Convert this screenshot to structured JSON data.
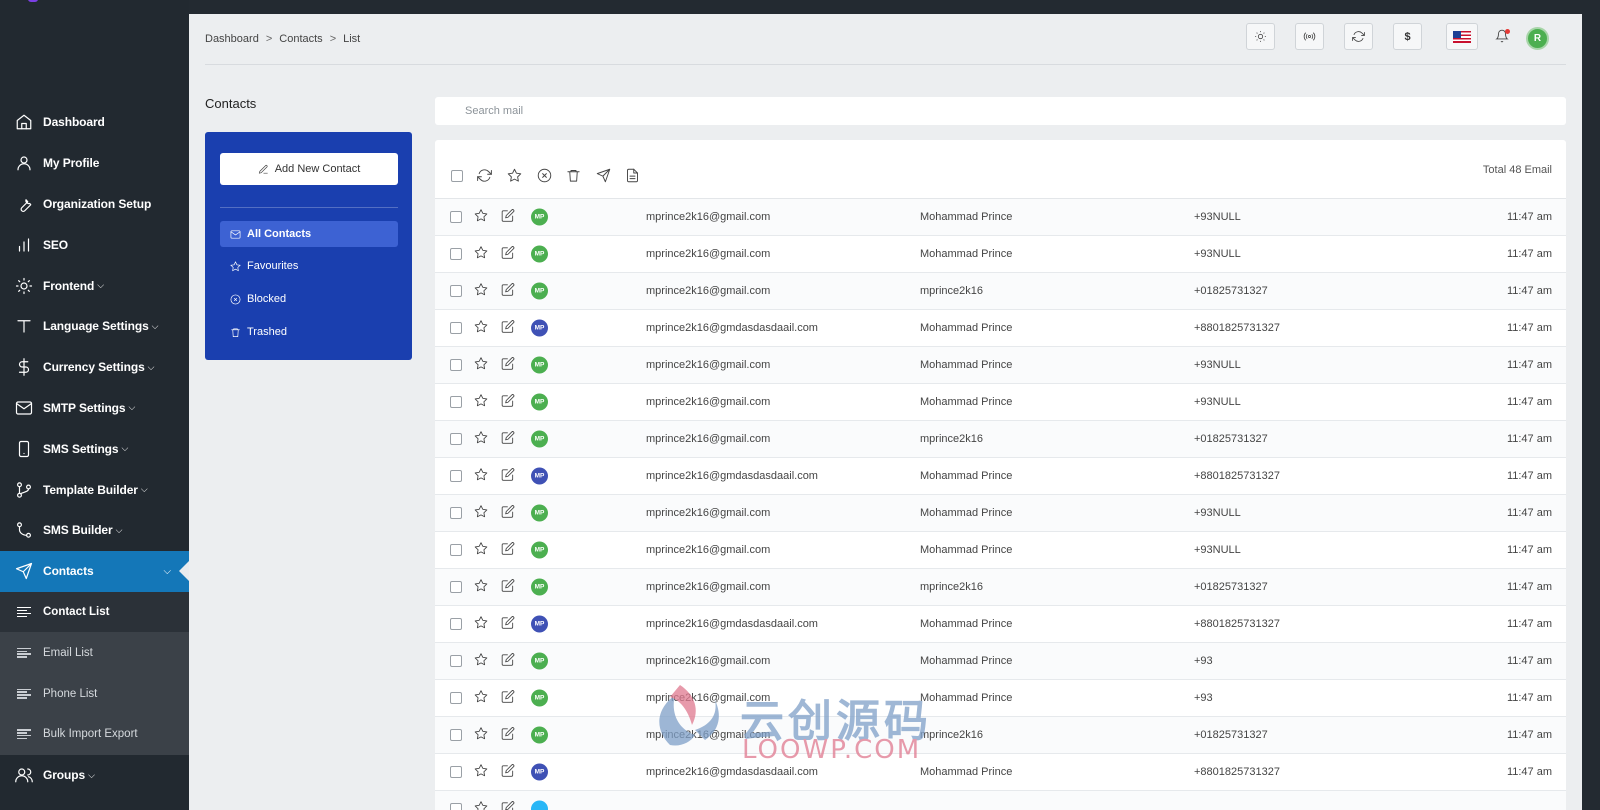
{
  "sidebar": {
    "items": [
      {
        "label": "Dashboard",
        "icon": "home-icon",
        "chevron": false
      },
      {
        "label": "My Profile",
        "icon": "user-icon",
        "chevron": false
      },
      {
        "label": "Organization Setup",
        "icon": "wrench-icon",
        "chevron": false
      },
      {
        "label": "SEO",
        "icon": "bar-chart-icon",
        "chevron": false
      },
      {
        "label": "Frontend",
        "icon": "sun-icon",
        "chevron": true
      },
      {
        "label": "Language Settings",
        "icon": "text-icon",
        "chevron": true
      },
      {
        "label": "Currency Settings",
        "icon": "dollar-icon",
        "chevron": true
      },
      {
        "label": "SMTP Settings",
        "icon": "mail-icon",
        "chevron": true
      },
      {
        "label": "SMS Settings",
        "icon": "phone-icon",
        "chevron": true
      },
      {
        "label": "Template Builder",
        "icon": "git-branch-icon",
        "chevron": true
      },
      {
        "label": "SMS Builder",
        "icon": "git-merge-icon",
        "chevron": true
      },
      {
        "label": "Contacts",
        "icon": "send-icon",
        "chevron": true,
        "active": true
      }
    ],
    "sub_items": [
      "Contact List",
      "Email List",
      "Phone List",
      "Bulk Import Export"
    ],
    "after_items": [
      {
        "label": "Groups",
        "icon": "users-icon",
        "chevron": true
      }
    ],
    "active_color": "#1477b8"
  },
  "header": {
    "breadcrumb": [
      "Dashboard",
      "Contacts",
      "List"
    ],
    "breadcrumb_sep": ">",
    "avatar_initial": "R",
    "currency_symbol": "$"
  },
  "contacts_panel": {
    "title": "Contacts",
    "add_button": "Add New Contact",
    "filters": [
      "All Contacts",
      "Favourites",
      "Blocked",
      "Trashed"
    ],
    "selected_filter": "All Contacts",
    "panel_color": "#1a3faf"
  },
  "search": {
    "placeholder": "Search mail"
  },
  "list": {
    "total_label": "Total 48 Email",
    "rows": [
      {
        "initials": "MP",
        "color": "#4caf50",
        "email": "mprince2k16@gmail.com",
        "name": "Mohammad Prince",
        "phone": "+93NULL",
        "time": "11:47 am"
      },
      {
        "initials": "MP",
        "color": "#4caf50",
        "email": "mprince2k16@gmail.com",
        "name": "Mohammad Prince",
        "phone": "+93NULL",
        "time": "11:47 am"
      },
      {
        "initials": "MP",
        "color": "#4caf50",
        "email": "mprince2k16@gmail.com",
        "name": "mprince2k16",
        "phone": "+01825731327",
        "time": "11:47 am"
      },
      {
        "initials": "MP",
        "color": "#3f51b5",
        "email": "mprince2k16@gmdasdasdaail.com",
        "name": "Mohammad Prince",
        "phone": "+8801825731327",
        "time": "11:47 am"
      },
      {
        "initials": "MP",
        "color": "#4caf50",
        "email": "mprince2k16@gmail.com",
        "name": "Mohammad Prince",
        "phone": "+93NULL",
        "time": "11:47 am"
      },
      {
        "initials": "MP",
        "color": "#4caf50",
        "email": "mprince2k16@gmail.com",
        "name": "Mohammad Prince",
        "phone": "+93NULL",
        "time": "11:47 am"
      },
      {
        "initials": "MP",
        "color": "#4caf50",
        "email": "mprince2k16@gmail.com",
        "name": "mprince2k16",
        "phone": "+01825731327",
        "time": "11:47 am"
      },
      {
        "initials": "MP",
        "color": "#3f51b5",
        "email": "mprince2k16@gmdasdasdaail.com",
        "name": "Mohammad Prince",
        "phone": "+8801825731327",
        "time": "11:47 am"
      },
      {
        "initials": "MP",
        "color": "#4caf50",
        "email": "mprince2k16@gmail.com",
        "name": "Mohammad Prince",
        "phone": "+93NULL",
        "time": "11:47 am"
      },
      {
        "initials": "MP",
        "color": "#4caf50",
        "email": "mprince2k16@gmail.com",
        "name": "Mohammad Prince",
        "phone": "+93NULL",
        "time": "11:47 am"
      },
      {
        "initials": "MP",
        "color": "#4caf50",
        "email": "mprince2k16@gmail.com",
        "name": "mprince2k16",
        "phone": "+01825731327",
        "time": "11:47 am"
      },
      {
        "initials": "MP",
        "color": "#3f51b5",
        "email": "mprince2k16@gmdasdasdaail.com",
        "name": "Mohammad Prince",
        "phone": "+8801825731327",
        "time": "11:47 am"
      },
      {
        "initials": "MP",
        "color": "#4caf50",
        "email": "mprince2k16@gmail.com",
        "name": "Mohammad Prince",
        "phone": "+93",
        "time": "11:47 am"
      },
      {
        "initials": "MP",
        "color": "#4caf50",
        "email": "mprince2k16@gmail.com",
        "name": "Mohammad Prince",
        "phone": "+93",
        "time": "11:47 am"
      },
      {
        "initials": "MP",
        "color": "#4caf50",
        "email": "mprince2k16@gmail.com",
        "name": "mprince2k16",
        "phone": "+01825731327",
        "time": "11:47 am"
      },
      {
        "initials": "MP",
        "color": "#3f51b5",
        "email": "mprince2k16@gmdasdasdaail.com",
        "name": "Mohammad Prince",
        "phone": "+8801825731327",
        "time": "11:47 am"
      },
      {
        "initials": "",
        "color": "#29b6f6",
        "email": "",
        "name": "",
        "phone": "",
        "time": ""
      }
    ]
  },
  "watermark": {
    "cn": "云创源码",
    "en": "LOOWP.COM"
  }
}
